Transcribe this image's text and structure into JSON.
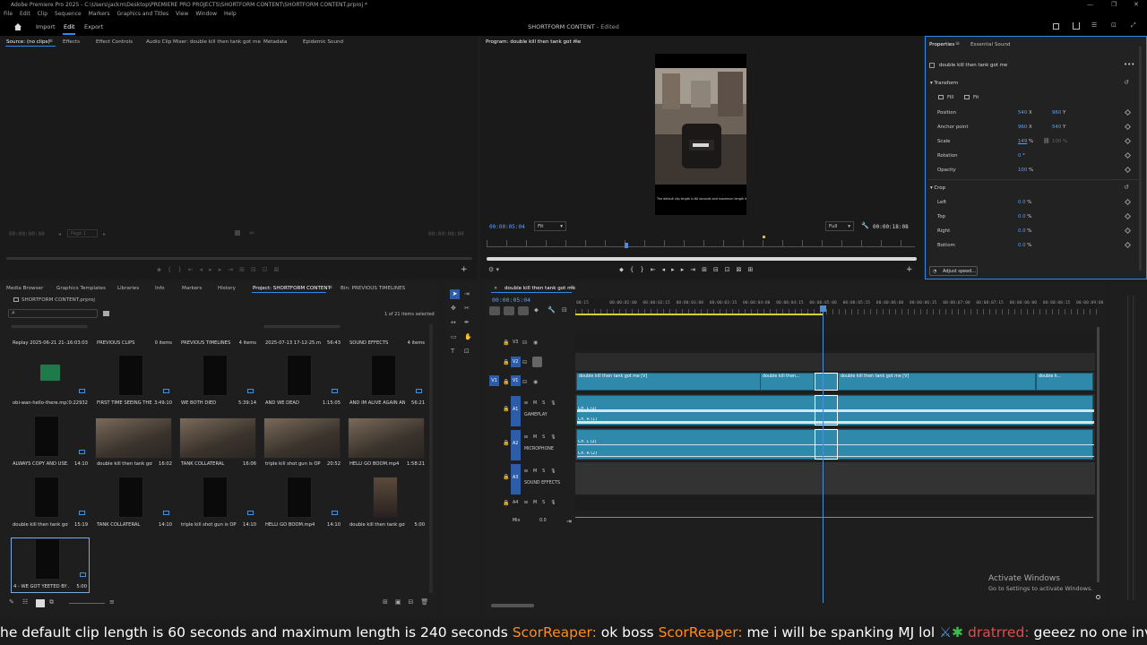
{
  "window": {
    "title": "Adobe Premiere Pro 2025 - C:\\Users\\jackm\\Desktop\\PREMIERE PRO PROJECTS\\SHORTFORM CONTENT\\SHORTFORM CONTENT.prproj *",
    "controls": [
      "—",
      "❐",
      "✕"
    ]
  },
  "menu": [
    "File",
    "Edit",
    "Clip",
    "Sequence",
    "Markers",
    "Graphics and Titles",
    "View",
    "Window",
    "Help"
  ],
  "header": {
    "tabs": [
      "Import",
      "Edit",
      "Export"
    ],
    "active_tab": "Edit",
    "project_title": "SHORTFORM CONTENT",
    "project_status": "- Edited"
  },
  "source_panel": {
    "tabs": [
      "Source: (no clips)",
      "Effects",
      "Effect Controls",
      "Audio Clip Mixer: double kill then tank got me",
      "Metadata",
      "Epidemic Sound"
    ],
    "tc_left": "00:00:00:00",
    "tc_right": "00:00:00:00",
    "page": "Page 1"
  },
  "program_panel": {
    "title": "Program: double kill then tank got me",
    "tc_current": "00:00:05:04",
    "fit": "Fit",
    "quality": "Full",
    "tc_duration": "00:00:18:08",
    "video_caption": "The default clip length is 60 seconds and maximum length is 24"
  },
  "properties_panel": {
    "tabs": [
      "Properties",
      "Essential Sound"
    ],
    "clip_name": "double kill then tank got me",
    "transform_label": "Transform",
    "fill_label": "Fill",
    "fit_label": "Fit",
    "rows": [
      {
        "label": "Position",
        "v1": "540",
        "a1": "X",
        "v2": "960",
        "a2": "Y"
      },
      {
        "label": "Anchor point",
        "v1": "960",
        "a1": "X",
        "v2": "540",
        "a2": "Y"
      },
      {
        "label": "Scale",
        "v1": "149",
        "a1": "%",
        "v2": "100",
        "a2": "%"
      },
      {
        "label": "Rotation",
        "v1": "0",
        "a1": "°",
        "v2": "",
        "a2": ""
      },
      {
        "label": "Opacity",
        "v1": "100",
        "a1": "%",
        "v2": "",
        "a2": ""
      }
    ],
    "crop_label": "Crop",
    "crop_rows": [
      {
        "label": "Left",
        "v": "0.0",
        "u": "%"
      },
      {
        "label": "Top",
        "v": "0.0",
        "u": "%"
      },
      {
        "label": "Right",
        "v": "0.0",
        "u": "%"
      },
      {
        "label": "Bottom",
        "v": "0.0",
        "u": "%"
      }
    ],
    "adjust_speed": "Adjust speed..."
  },
  "project_panel": {
    "tabs": [
      "Media Browser",
      "Graphics Templates",
      "Libraries",
      "Info",
      "Markers",
      "History",
      "Project: SHORTFORM CONTENT",
      "Bin: PREVIOUS TIMELINES"
    ],
    "project_file": "SHORTFORM CONTENT.prproj",
    "selection_count": "1 of 21 items selected",
    "items": [
      {
        "name": "Replay 2025-06-21 21-...",
        "meta": "16:03:03",
        "kind": "video"
      },
      {
        "name": "PREVIOUS CLIPS",
        "meta": "0 items",
        "kind": "bin"
      },
      {
        "name": "PREVIOUS TIMELINES",
        "meta": "4 items",
        "kind": "bin"
      },
      {
        "name": "2025-07-13 17-12-25.mp4",
        "meta": "56:43",
        "kind": "video"
      },
      {
        "name": "SOUND EFFECTS",
        "meta": "4 items",
        "kind": "bin"
      },
      {
        "name": "obi-wan-hello-there.mp3",
        "meta": "0:22932",
        "kind": "audio"
      },
      {
        "name": "FIRST TIME SEEING THE...",
        "meta": "3:49:10",
        "kind": "seq"
      },
      {
        "name": "WE BOTH DIED",
        "meta": "5:39:14",
        "kind": "seq"
      },
      {
        "name": "AND WE DEAD",
        "meta": "1:15:05",
        "kind": "seq"
      },
      {
        "name": "AND IM ALIVE AGAIN AN...",
        "meta": "56:21",
        "kind": "seq"
      },
      {
        "name": "ALWAYS COPY AND USE...",
        "meta": "14:10",
        "kind": "seq"
      },
      {
        "name": "double kill then tank got me",
        "meta": "16:02",
        "kind": "img"
      },
      {
        "name": "TANK COLLATERAL",
        "meta": "16:06",
        "kind": "img"
      },
      {
        "name": "triple kill shot gun is OP",
        "meta": "20:52",
        "kind": "img"
      },
      {
        "name": "HELLI GO BOOM.mp4",
        "meta": "1:58:21",
        "kind": "img"
      },
      {
        "name": "double kill then tank got me",
        "meta": "15:19",
        "kind": "seq"
      },
      {
        "name": "TANK COLLATERAL",
        "meta": "14:10",
        "kind": "seq"
      },
      {
        "name": "triple kill shot gun is OP",
        "meta": "14:10",
        "kind": "seq"
      },
      {
        "name": "HELLI GO BOOM.mp4",
        "meta": "14:10",
        "kind": "seq"
      },
      {
        "name": "double kill then tank got me...",
        "meta": "5:00",
        "kind": "tall"
      },
      {
        "name": "4 - WE GOT YEETED BY A...",
        "meta": "5:00",
        "kind": "seq"
      }
    ]
  },
  "timeline": {
    "sequence_name": "double kill then tank got me",
    "tc_current": "00:00:05:04",
    "ruler": [
      "00:15",
      "00:00:02:00",
      "00:00:02:15",
      "00:00:03:00",
      "00:00:03:15",
      "00:00:04:00",
      "00:00:04:15",
      "00:00:05:00",
      "00:00:05:15",
      "00:00:06:00",
      "00:00:06:15",
      "00:00:07:00",
      "00:00:07:15",
      "00:00:08:00",
      "00:00:08:15",
      "00:00:09:00"
    ],
    "tracks": [
      {
        "id": "V3",
        "name": ""
      },
      {
        "id": "V2",
        "name": ""
      },
      {
        "id": "V1",
        "name": ""
      },
      {
        "id": "A1",
        "name": "GAMEPLAY"
      },
      {
        "id": "A2",
        "name": "MICROPHONE"
      },
      {
        "id": "A3",
        "name": "SOUND EFFECTS"
      },
      {
        "id": "A4",
        "name": ""
      }
    ],
    "mix_label": "Mix",
    "mix_value": "0.0",
    "video_clips": [
      "double kill then tank got me [V]",
      "double kill then...",
      "double kill then tank got me [V]",
      "double k..."
    ],
    "audio_labels": [
      "Ch. L (1)",
      "Ch. R (1)",
      "Ch. L (2)",
      "Ch. R (2)"
    ]
  },
  "watermark": {
    "line1": "Activate Windows",
    "line2": "Go to Settings to activate Windows."
  },
  "chat": {
    "seg1": "he default clip length is 60 seconds and maximum length is 240 seconds",
    "name1": "ScorReaper:",
    "msg1": "ok boss",
    "name2": "ScorReaper:",
    "msg2": "me i will be spanking MJ lol",
    "name3": "dratrred:",
    "msg3": "geeez no one invite"
  },
  "colors": {
    "accent": "#2f89ab",
    "blue_text": "#5aa0ff",
    "playhead": "#4a8fd6"
  }
}
